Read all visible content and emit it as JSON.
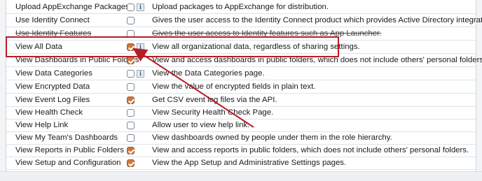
{
  "permissions": [
    {
      "name": "Upload AppExchange Packages",
      "checked": false,
      "info": true,
      "description": "Upload packages to AppExchange for distribution.",
      "strike": false
    },
    {
      "name": "Use Identity Connect",
      "checked": false,
      "info": false,
      "description": "Gives the user access to the Identity Connect product which provides Active Directory integration.",
      "strike": false
    },
    {
      "name": "Use Identity Features",
      "checked": false,
      "info": false,
      "description": "Gives the user access to Identity features such as App Launcher.",
      "strike": true
    },
    {
      "name": "View All Data",
      "checked": true,
      "info": true,
      "description": "View all organizational data, regardless of sharing settings.",
      "strike": false
    },
    {
      "name": "View Dashboards in Public Folders",
      "checked": true,
      "info": false,
      "description": "View and access dashboards in public folders, which does not include others' personal folders.",
      "strike": false
    },
    {
      "name": "View Data Categories",
      "checked": false,
      "info": true,
      "description": "View the Data Categories page.",
      "strike": false
    },
    {
      "name": "View Encrypted Data",
      "checked": false,
      "info": false,
      "description": "View the value of encrypted fields in plain text.",
      "strike": false
    },
    {
      "name": "View Event Log Files",
      "checked": true,
      "info": false,
      "description": "Get CSV event log files via the API.",
      "strike": false
    },
    {
      "name": "View Health Check",
      "checked": false,
      "info": false,
      "description": "View Security Health Check Page.",
      "strike": false
    },
    {
      "name": "View Help Link",
      "checked": false,
      "info": false,
      "description": "Allow user to view help link.",
      "strike": false
    },
    {
      "name": "View My Team's Dashboards",
      "checked": false,
      "info": false,
      "description": "View dashboards owned by people under them in the role hierarchy.",
      "strike": false
    },
    {
      "name": "View Reports in Public Folders",
      "checked": true,
      "info": false,
      "description": "View and access reports in public folders, which does not include others' personal folders.",
      "strike": false
    },
    {
      "name": "View Setup and Configuration",
      "checked": true,
      "info": false,
      "description": "View the App Setup and Administrative Settings pages.",
      "strike": false
    }
  ],
  "info_glyph": "i",
  "colors": {
    "accent": "#c9773e",
    "highlight": "#b81c26"
  }
}
